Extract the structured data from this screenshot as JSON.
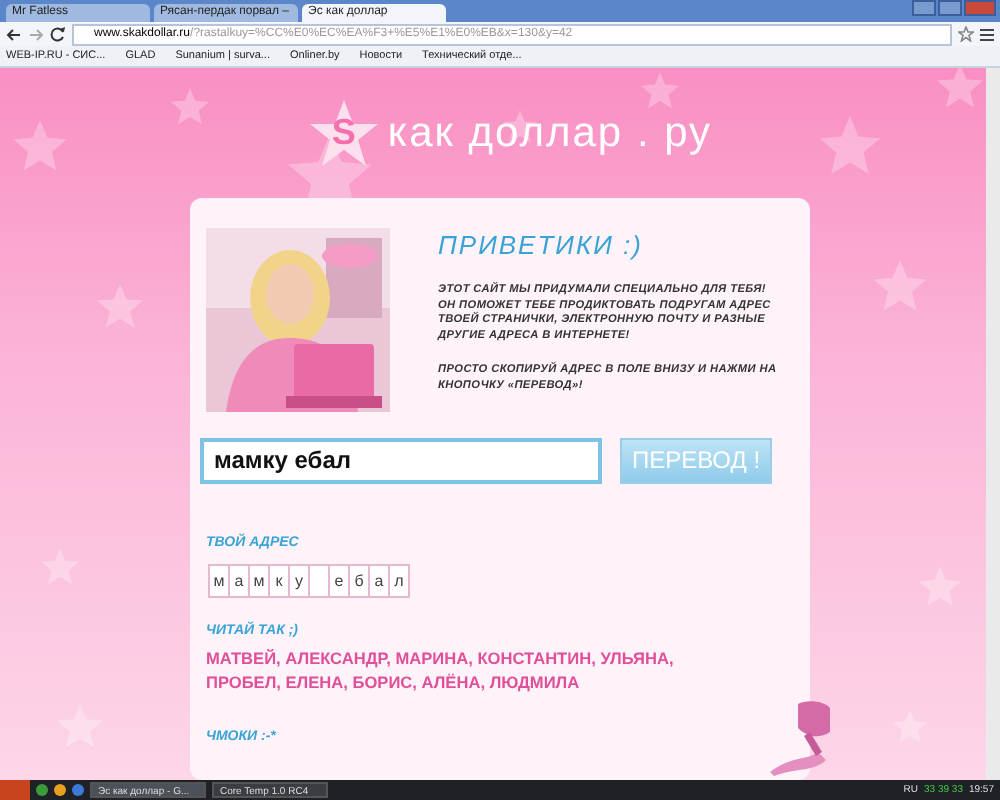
{
  "browser": {
    "tabs": [
      {
        "title": "Mr Fatless",
        "selected": false
      },
      {
        "title": "Рясан-пердак порвал –",
        "selected": false
      },
      {
        "title": "Эс как доллар",
        "selected": true
      }
    ],
    "url_host": "www.skakdollar.ru",
    "url_rest": "/?rastalkuy=%CC%E0%EC%EA%F3+%E5%E1%E0%EB&x=130&y=42",
    "bookmarks": [
      "WEB-IP.RU - CИC...",
      "GLAD",
      "Sunanium | surva...",
      "Onliner.by",
      "Новости",
      "Технический отде..."
    ]
  },
  "logo": {
    "letter": "S",
    "text": "как доллар . ру"
  },
  "intro": {
    "heading": "ПРИВЕТИКИ :)",
    "paragraphs": [
      "ЭТОТ САЙТ МЫ ПРИДУМАЛИ СПЕЦИАЛЬНО ДЛЯ ТЕБЯ! ОН ПОМОЖЕТ ТЕБЕ ПРОДИКТОВАТЬ ПОДРУГАМ АДРЕС ТВОЕЙ СТРАНИЧКИ, ЭЛЕКТРОННУЮ ПОЧТУ И РАЗНЫЕ ДРУГИЕ АДРЕСА В ИНТЕРНЕТЕ!",
      "ПРОСТО СКОПИРУЙ АДРЕС В ПОЛЕ ВНИЗУ И НАЖМИ НА КНОПОЧКУ «ПЕРЕВОД»!"
    ]
  },
  "form": {
    "value": "мамку ебал",
    "button": "ПЕРЕВОД !"
  },
  "address": {
    "label": "ТВОЙ АДРЕС",
    "letters": [
      {
        "kind": "letter",
        "char": "м"
      },
      {
        "kind": "letter",
        "char": "а"
      },
      {
        "kind": "letter",
        "char": "м"
      },
      {
        "kind": "letter",
        "char": "к"
      },
      {
        "kind": "letter",
        "char": "у"
      },
      {
        "kind": "space"
      },
      {
        "kind": "letter",
        "char": "е"
      },
      {
        "kind": "letter",
        "char": "б"
      },
      {
        "kind": "letter",
        "char": "а"
      },
      {
        "kind": "letter",
        "char": "л"
      }
    ]
  },
  "read": {
    "label": "ЧИТАЙ ТАК ;)",
    "text": "МАТВЕЙ, АЛЕКСАНДР, МАРИНА, КОНСТАНТИН, УЛЬЯНА, ПРОБЕЛ, ЕЛЕНА, БОРИС, АЛЁНА, ЛЮДМИЛА"
  },
  "farewell": "ЧМОКИ :-*",
  "taskbar": {
    "tasks": [
      {
        "title": "Эс как доллар - G...",
        "selected": true
      },
      {
        "title": "Core Temp 1.0 RC4",
        "selected": false
      }
    ],
    "language": "RU",
    "temps": "33 39 33",
    "clock": "19:57"
  }
}
